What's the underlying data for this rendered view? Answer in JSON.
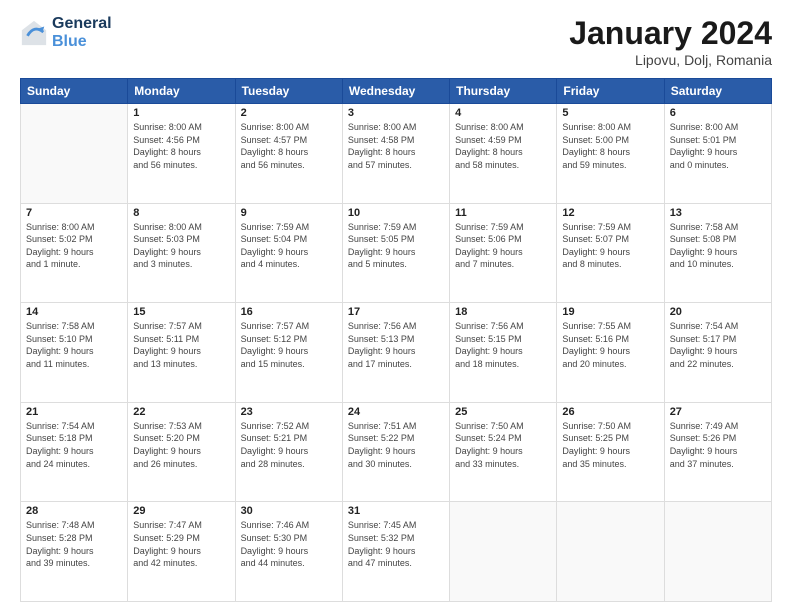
{
  "header": {
    "logo_line1": "General",
    "logo_line2": "Blue",
    "month": "January 2024",
    "location": "Lipovu, Dolj, Romania"
  },
  "weekdays": [
    "Sunday",
    "Monday",
    "Tuesday",
    "Wednesday",
    "Thursday",
    "Friday",
    "Saturday"
  ],
  "weeks": [
    [
      {
        "day": "",
        "info": ""
      },
      {
        "day": "1",
        "info": "Sunrise: 8:00 AM\nSunset: 4:56 PM\nDaylight: 8 hours\nand 56 minutes."
      },
      {
        "day": "2",
        "info": "Sunrise: 8:00 AM\nSunset: 4:57 PM\nDaylight: 8 hours\nand 56 minutes."
      },
      {
        "day": "3",
        "info": "Sunrise: 8:00 AM\nSunset: 4:58 PM\nDaylight: 8 hours\nand 57 minutes."
      },
      {
        "day": "4",
        "info": "Sunrise: 8:00 AM\nSunset: 4:59 PM\nDaylight: 8 hours\nand 58 minutes."
      },
      {
        "day": "5",
        "info": "Sunrise: 8:00 AM\nSunset: 5:00 PM\nDaylight: 8 hours\nand 59 minutes."
      },
      {
        "day": "6",
        "info": "Sunrise: 8:00 AM\nSunset: 5:01 PM\nDaylight: 9 hours\nand 0 minutes."
      }
    ],
    [
      {
        "day": "7",
        "info": "Sunrise: 8:00 AM\nSunset: 5:02 PM\nDaylight: 9 hours\nand 1 minute."
      },
      {
        "day": "8",
        "info": "Sunrise: 8:00 AM\nSunset: 5:03 PM\nDaylight: 9 hours\nand 3 minutes."
      },
      {
        "day": "9",
        "info": "Sunrise: 7:59 AM\nSunset: 5:04 PM\nDaylight: 9 hours\nand 4 minutes."
      },
      {
        "day": "10",
        "info": "Sunrise: 7:59 AM\nSunset: 5:05 PM\nDaylight: 9 hours\nand 5 minutes."
      },
      {
        "day": "11",
        "info": "Sunrise: 7:59 AM\nSunset: 5:06 PM\nDaylight: 9 hours\nand 7 minutes."
      },
      {
        "day": "12",
        "info": "Sunrise: 7:59 AM\nSunset: 5:07 PM\nDaylight: 9 hours\nand 8 minutes."
      },
      {
        "day": "13",
        "info": "Sunrise: 7:58 AM\nSunset: 5:08 PM\nDaylight: 9 hours\nand 10 minutes."
      }
    ],
    [
      {
        "day": "14",
        "info": "Sunrise: 7:58 AM\nSunset: 5:10 PM\nDaylight: 9 hours\nand 11 minutes."
      },
      {
        "day": "15",
        "info": "Sunrise: 7:57 AM\nSunset: 5:11 PM\nDaylight: 9 hours\nand 13 minutes."
      },
      {
        "day": "16",
        "info": "Sunrise: 7:57 AM\nSunset: 5:12 PM\nDaylight: 9 hours\nand 15 minutes."
      },
      {
        "day": "17",
        "info": "Sunrise: 7:56 AM\nSunset: 5:13 PM\nDaylight: 9 hours\nand 17 minutes."
      },
      {
        "day": "18",
        "info": "Sunrise: 7:56 AM\nSunset: 5:15 PM\nDaylight: 9 hours\nand 18 minutes."
      },
      {
        "day": "19",
        "info": "Sunrise: 7:55 AM\nSunset: 5:16 PM\nDaylight: 9 hours\nand 20 minutes."
      },
      {
        "day": "20",
        "info": "Sunrise: 7:54 AM\nSunset: 5:17 PM\nDaylight: 9 hours\nand 22 minutes."
      }
    ],
    [
      {
        "day": "21",
        "info": "Sunrise: 7:54 AM\nSunset: 5:18 PM\nDaylight: 9 hours\nand 24 minutes."
      },
      {
        "day": "22",
        "info": "Sunrise: 7:53 AM\nSunset: 5:20 PM\nDaylight: 9 hours\nand 26 minutes."
      },
      {
        "day": "23",
        "info": "Sunrise: 7:52 AM\nSunset: 5:21 PM\nDaylight: 9 hours\nand 28 minutes."
      },
      {
        "day": "24",
        "info": "Sunrise: 7:51 AM\nSunset: 5:22 PM\nDaylight: 9 hours\nand 30 minutes."
      },
      {
        "day": "25",
        "info": "Sunrise: 7:50 AM\nSunset: 5:24 PM\nDaylight: 9 hours\nand 33 minutes."
      },
      {
        "day": "26",
        "info": "Sunrise: 7:50 AM\nSunset: 5:25 PM\nDaylight: 9 hours\nand 35 minutes."
      },
      {
        "day": "27",
        "info": "Sunrise: 7:49 AM\nSunset: 5:26 PM\nDaylight: 9 hours\nand 37 minutes."
      }
    ],
    [
      {
        "day": "28",
        "info": "Sunrise: 7:48 AM\nSunset: 5:28 PM\nDaylight: 9 hours\nand 39 minutes."
      },
      {
        "day": "29",
        "info": "Sunrise: 7:47 AM\nSunset: 5:29 PM\nDaylight: 9 hours\nand 42 minutes."
      },
      {
        "day": "30",
        "info": "Sunrise: 7:46 AM\nSunset: 5:30 PM\nDaylight: 9 hours\nand 44 minutes."
      },
      {
        "day": "31",
        "info": "Sunrise: 7:45 AM\nSunset: 5:32 PM\nDaylight: 9 hours\nand 47 minutes."
      },
      {
        "day": "",
        "info": ""
      },
      {
        "day": "",
        "info": ""
      },
      {
        "day": "",
        "info": ""
      }
    ]
  ]
}
